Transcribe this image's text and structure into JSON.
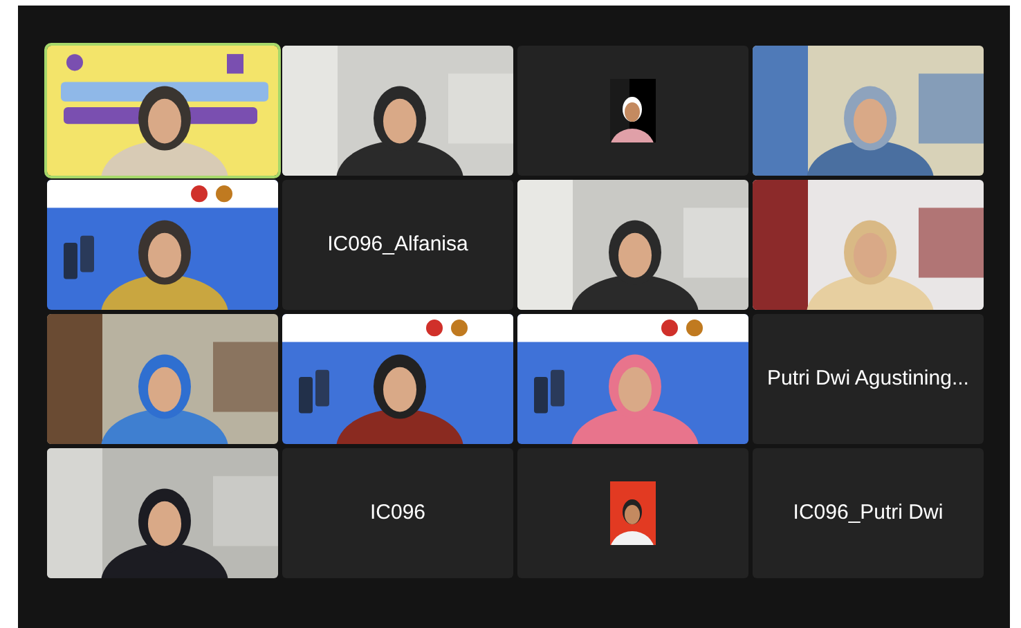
{
  "tiles": [
    {
      "kind": "video",
      "active": true
    },
    {
      "kind": "video",
      "active": false
    },
    {
      "kind": "avatar",
      "active": false
    },
    {
      "kind": "video",
      "active": false
    },
    {
      "kind": "video",
      "active": false
    },
    {
      "kind": "name",
      "active": false,
      "name": "IC096_Alfanisa"
    },
    {
      "kind": "video",
      "active": false
    },
    {
      "kind": "video",
      "active": false
    },
    {
      "kind": "video",
      "active": false
    },
    {
      "kind": "video",
      "active": false
    },
    {
      "kind": "video",
      "active": false
    },
    {
      "kind": "name",
      "active": false,
      "name": "Putri Dwi Agustining..."
    },
    {
      "kind": "video",
      "active": false
    },
    {
      "kind": "name",
      "active": false,
      "name": "IC096"
    },
    {
      "kind": "avatar",
      "active": false
    },
    {
      "kind": "name",
      "active": false,
      "name": "IC096_Putri Dwi"
    }
  ]
}
